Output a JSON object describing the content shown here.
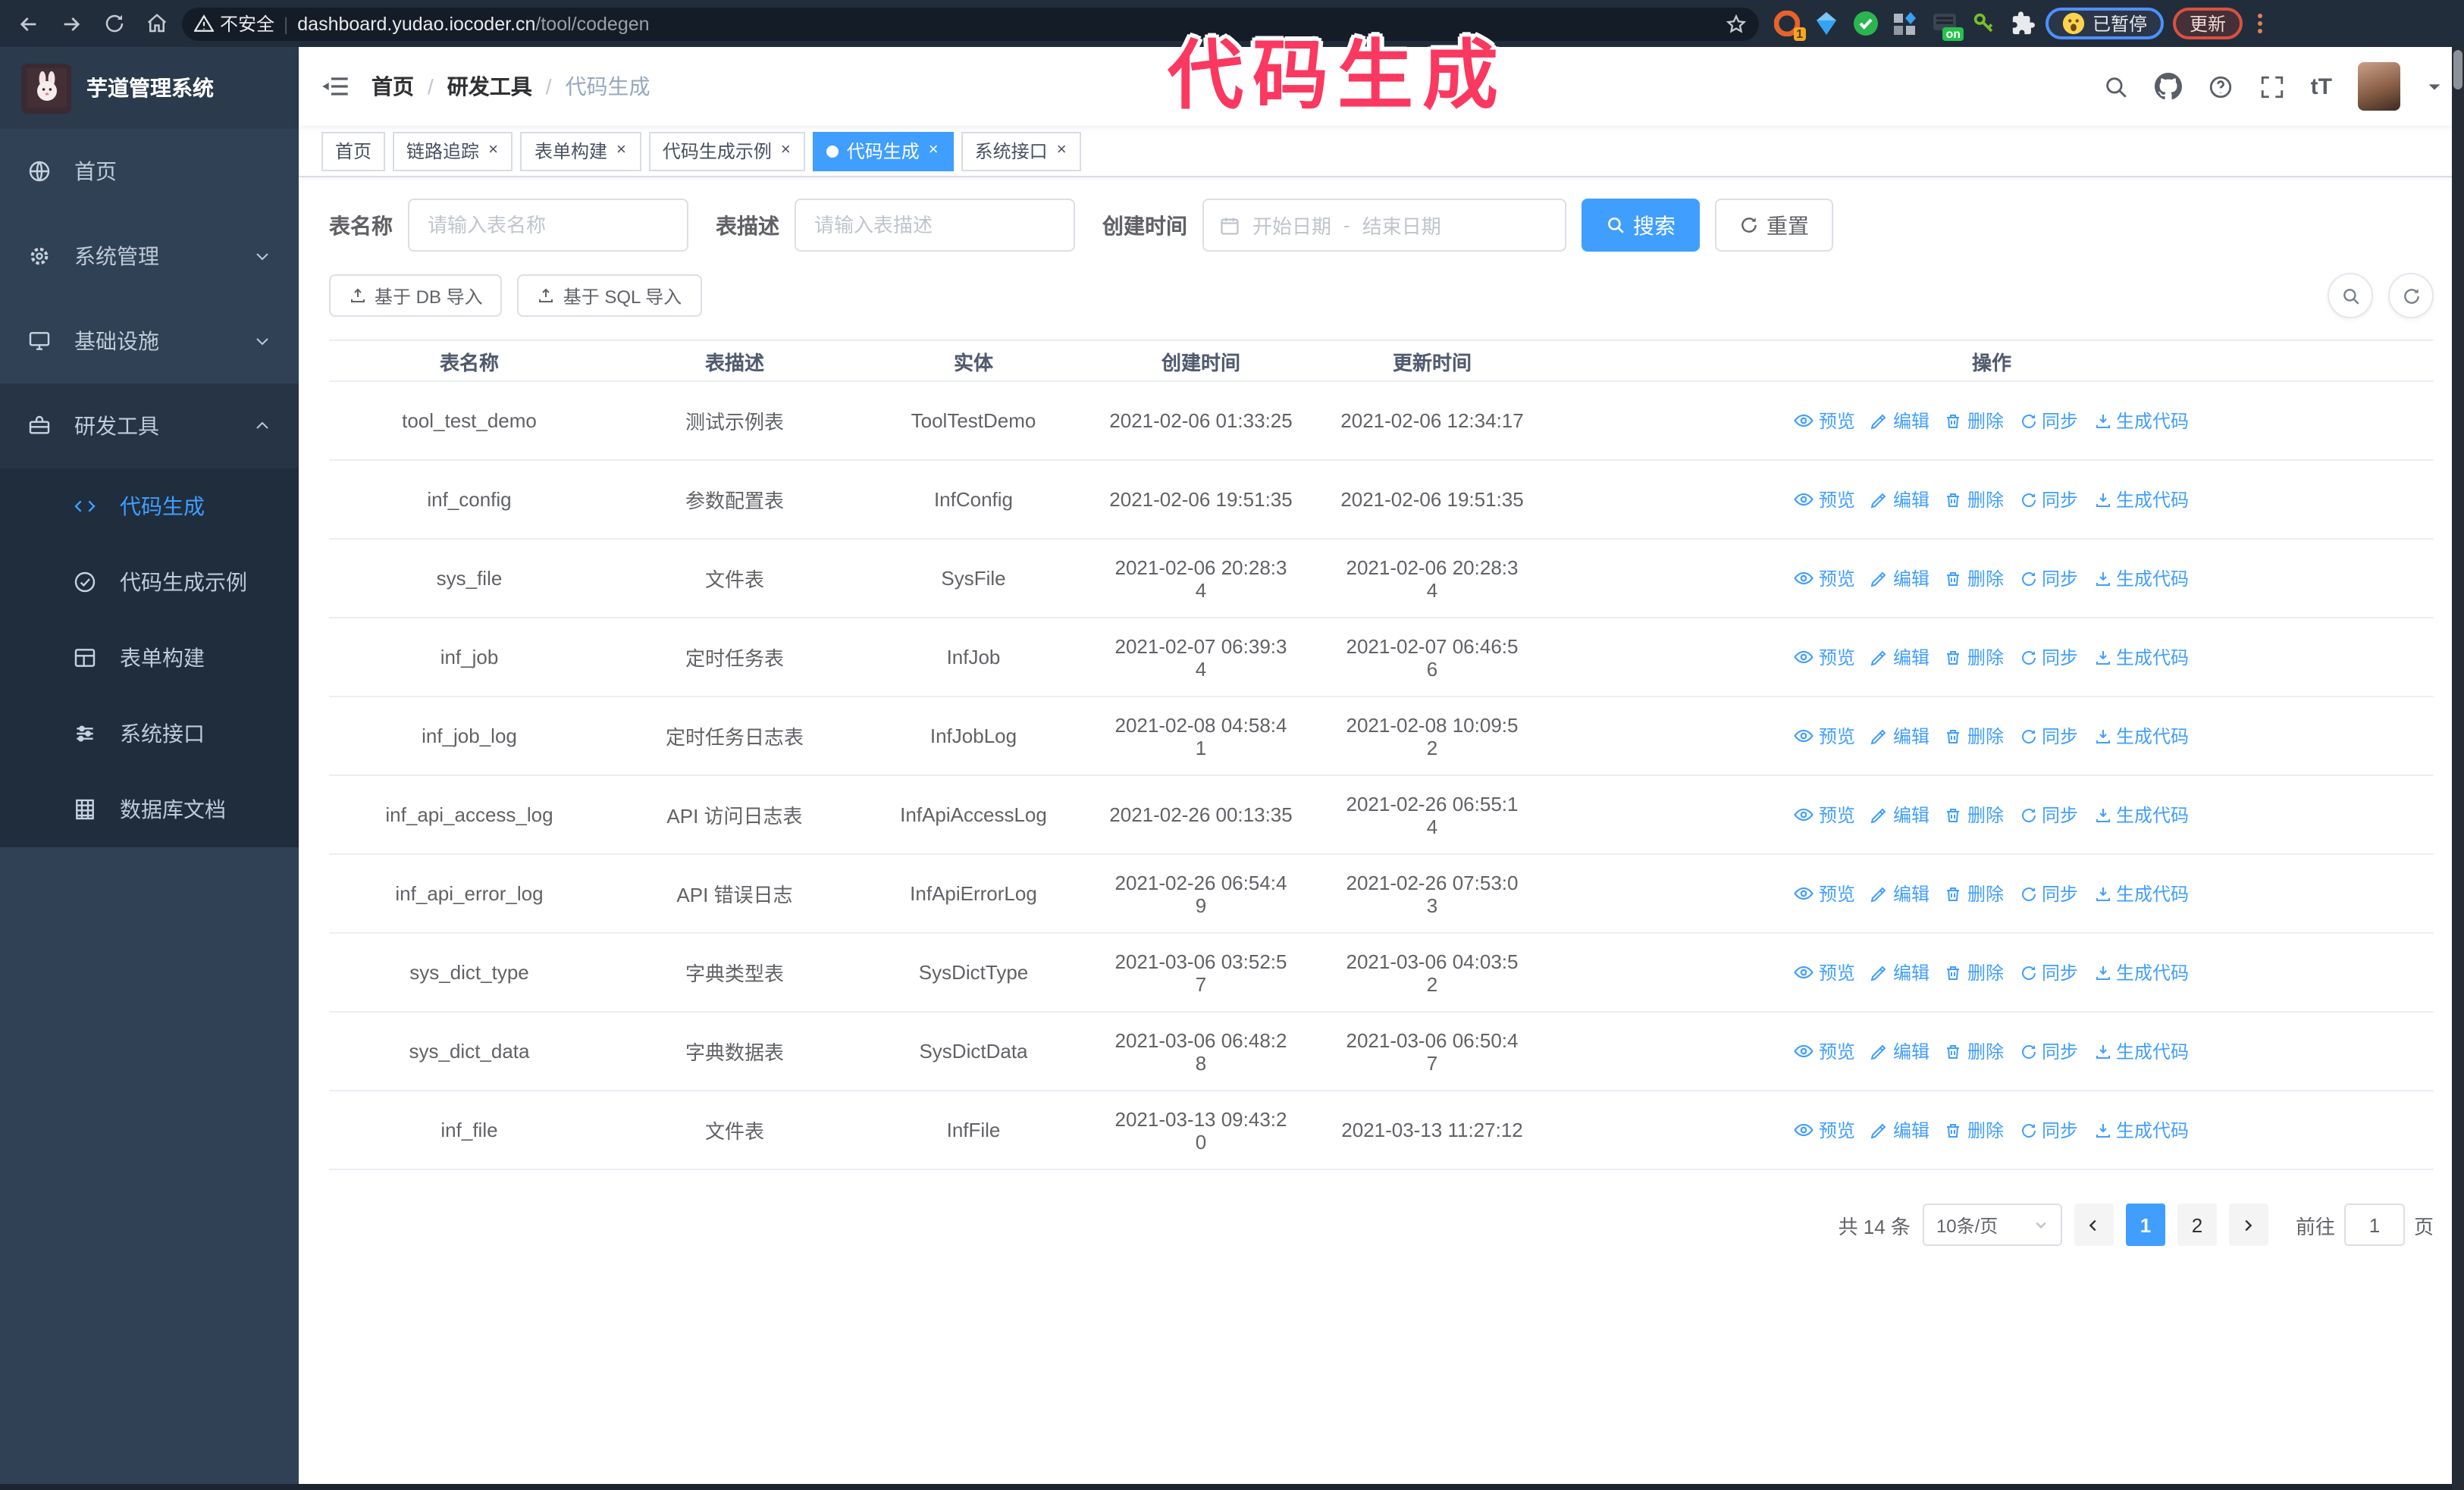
{
  "browser": {
    "security_label": "不安全",
    "url_host": "dashboard.yudao.iocoder.cn",
    "url_path": "/tool/codegen",
    "ext_badge": "1",
    "on_badge": "on",
    "profile_label": "已暂停",
    "update_label": "更新"
  },
  "annotation": {
    "text": "代码生成",
    "color": "#fa3860"
  },
  "sidebar": {
    "logo_title": "芋道管理系统",
    "items": [
      {
        "label": "首页",
        "icon": "home",
        "chevron": null,
        "open": false
      },
      {
        "label": "系统管理",
        "icon": "gear",
        "chevron": "down",
        "open": false
      },
      {
        "label": "基础设施",
        "icon": "monitor",
        "chevron": "down",
        "open": false
      },
      {
        "label": "研发工具",
        "icon": "toolbox",
        "chevron": "up",
        "open": true
      }
    ],
    "submenu": [
      {
        "label": "代码生成",
        "icon": "code",
        "active": true
      },
      {
        "label": "代码生成示例",
        "icon": "check-circle",
        "active": false
      },
      {
        "label": "表单构建",
        "icon": "form",
        "active": false
      },
      {
        "label": "系统接口",
        "icon": "sliders",
        "active": false
      },
      {
        "label": "数据库文档",
        "icon": "dbdoc",
        "active": false
      }
    ]
  },
  "header": {
    "breadcrumb": [
      "首页",
      "研发工具",
      "代码生成"
    ],
    "font_icon_text": "tT"
  },
  "tabs": [
    {
      "label": "首页",
      "closable": false,
      "active": false
    },
    {
      "label": "链路追踪",
      "closable": true,
      "active": false
    },
    {
      "label": "表单构建",
      "closable": true,
      "active": false
    },
    {
      "label": "代码生成示例",
      "closable": true,
      "active": false
    },
    {
      "label": "代码生成",
      "closable": true,
      "active": true
    },
    {
      "label": "系统接口",
      "closable": true,
      "active": false
    }
  ],
  "filters": {
    "name_label": "表名称",
    "name_placeholder": "请输入表名称",
    "desc_label": "表描述",
    "desc_placeholder": "请输入表描述",
    "time_label": "创建时间",
    "start_placeholder": "开始日期",
    "range_separator": "-",
    "end_placeholder": "结束日期",
    "search_label": "搜索",
    "reset_label": "重置"
  },
  "toolbar": {
    "db_import_label": "基于 DB 导入",
    "sql_import_label": "基于 SQL 导入"
  },
  "table": {
    "headers": [
      "表名称",
      "表描述",
      "实体",
      "创建时间",
      "更新时间",
      "操作"
    ],
    "actions": [
      {
        "label": "预览",
        "icon": "eye"
      },
      {
        "label": "编辑",
        "icon": "edit"
      },
      {
        "label": "删除",
        "icon": "delete"
      },
      {
        "label": "同步",
        "icon": "sync"
      },
      {
        "label": "生成代码",
        "icon": "download"
      }
    ],
    "rows": [
      {
        "name": "tool_test_demo",
        "desc": "测试示例表",
        "entity": "ToolTestDemo",
        "created": "2021-02-06 01:33:25",
        "updated": "2021-02-06 12:34:17"
      },
      {
        "name": "inf_config",
        "desc": "参数配置表",
        "entity": "InfConfig",
        "created": "2021-02-06 19:51:35",
        "updated": "2021-02-06 19:51:35"
      },
      {
        "name": "sys_file",
        "desc": "文件表",
        "entity": "SysFile",
        "created": "2021-02-06 20:28:3\n4",
        "updated": "2021-02-06 20:28:3\n4"
      },
      {
        "name": "inf_job",
        "desc": "定时任务表",
        "entity": "InfJob",
        "created": "2021-02-07 06:39:3\n4",
        "updated": "2021-02-07 06:46:5\n6"
      },
      {
        "name": "inf_job_log",
        "desc": "定时任务日志表",
        "entity": "InfJobLog",
        "created": "2021-02-08 04:58:4\n1",
        "updated": "2021-02-08 10:09:5\n2"
      },
      {
        "name": "inf_api_access_log",
        "desc": "API 访问日志表",
        "entity": "InfApiAccessLog",
        "created": "2021-02-26 00:13:35",
        "updated": "2021-02-26 06:55:1\n4"
      },
      {
        "name": "inf_api_error_log",
        "desc": "API 错误日志",
        "entity": "InfApiErrorLog",
        "created": "2021-02-26 06:54:4\n9",
        "updated": "2021-02-26 07:53:0\n3"
      },
      {
        "name": "sys_dict_type",
        "desc": "字典类型表",
        "entity": "SysDictType",
        "created": "2021-03-06 03:52:5\n7",
        "updated": "2021-03-06 04:03:5\n2"
      },
      {
        "name": "sys_dict_data",
        "desc": "字典数据表",
        "entity": "SysDictData",
        "created": "2021-03-06 06:48:2\n8",
        "updated": "2021-03-06 06:50:4\n7"
      },
      {
        "name": "inf_file",
        "desc": "文件表",
        "entity": "InfFile",
        "created": "2021-03-13 09:43:2\n0",
        "updated": "2021-03-13 11:27:12"
      }
    ]
  },
  "pagination": {
    "total": "共 14 条",
    "per_page": "10条/页",
    "pages": [
      "1",
      "2"
    ],
    "current": "1",
    "goto_label": "前往",
    "goto_value": "1",
    "page_unit": "页"
  }
}
